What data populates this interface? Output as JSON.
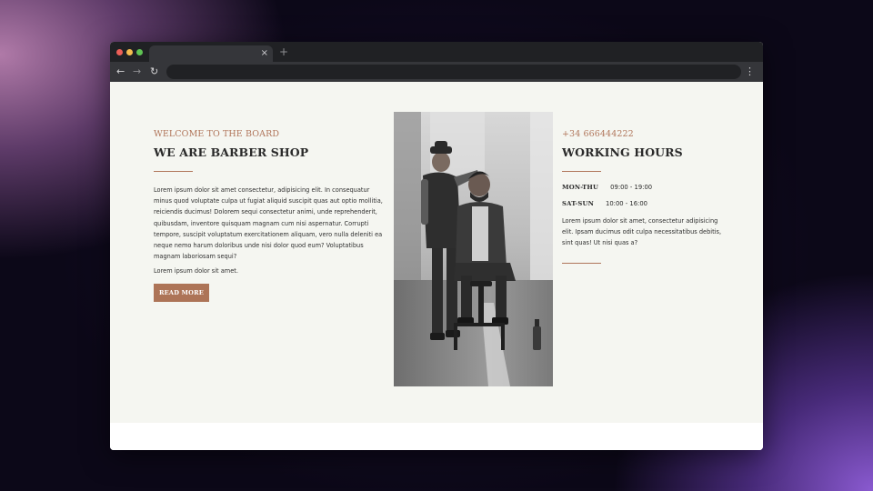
{
  "browser": {
    "tab_close_glyph": "×",
    "new_tab_glyph": "+",
    "back_glyph": "←",
    "forward_glyph": "→",
    "reload_glyph": "↻",
    "menu_glyph": "⋮",
    "traffic_light_colors": [
      "#ed5f57",
      "#f5bd4f",
      "#5fc454"
    ]
  },
  "about": {
    "eyebrow": "WELCOME TO THE BOARD",
    "title": "WE ARE BARBER SHOP",
    "paragraph_1": "Lorem ipsum dolor sit amet consectetur, adipisicing elit. In consequatur minus quod voluptate culpa ut fugiat aliquid suscipit quas aut optio mollitia, reiciendis ducimus! Dolorem sequi consectetur animi, unde reprehenderit, quibusdam, inventore quisquam magnam cum nisi aspernatur. Corrupti tempore, suscipit voluptatum exercitationem aliquam, vero nulla deleniti ea neque nemo harum doloribus unde nisi dolor quod eum? Voluptatibus magnam laboriosam sequi?",
    "paragraph_2": "Lorem ipsum dolor sit amet.",
    "button_label": "READ MORE"
  },
  "photo": {
    "icon": "barber-photo"
  },
  "contact": {
    "phone": "+34 666444222",
    "title": "WORKING HOURS",
    "hours": [
      {
        "day": "MON-THU",
        "time": "09:00 - 19:00"
      },
      {
        "day": "SAT-SUN",
        "time": "10:00 - 16:00"
      }
    ],
    "paragraph": "Lorem ipsum dolor sit amet, consectetur adipisicing elit. Ipsam ducimus odit culpa necessitatibus debitis, sint quas! Ut nisi quas a?"
  },
  "colors": {
    "accent": "#b0755a",
    "button": "#ad7457",
    "page_background": "#f5f6f1"
  }
}
